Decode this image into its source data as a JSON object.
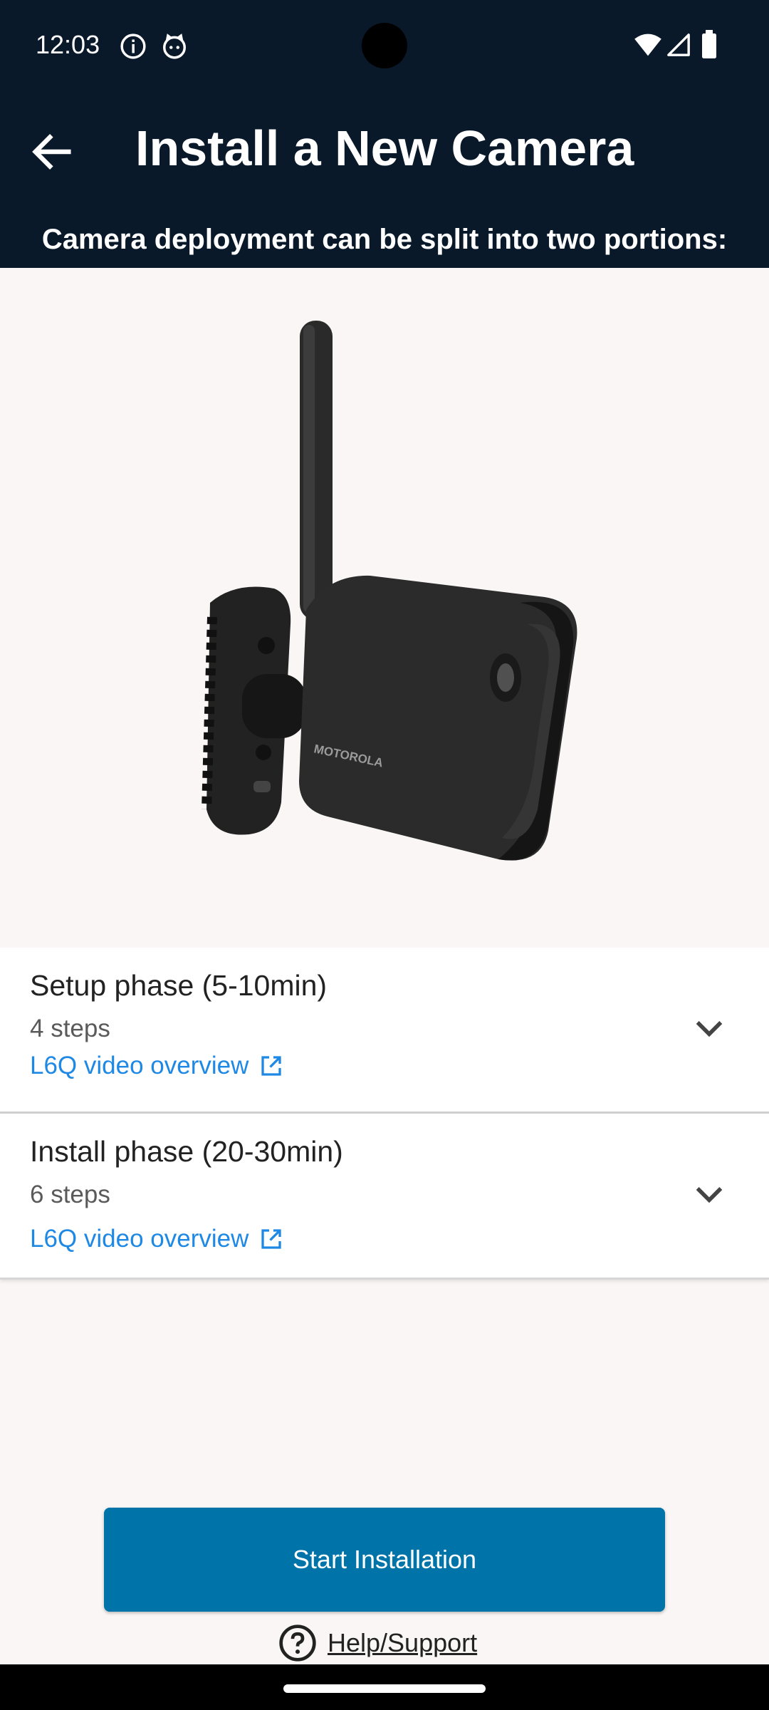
{
  "status_bar": {
    "time": "12:03",
    "icons": [
      "info-icon",
      "cat-icon",
      "wifi-icon",
      "signal-icon",
      "battery-icon"
    ]
  },
  "app_bar": {
    "title": "Install a New Camera",
    "back_icon": "arrow-back-icon"
  },
  "subtitle": "Camera deployment can be split into two portions:",
  "hero": {
    "brand_mark": "MOTOROLA"
  },
  "phases": [
    {
      "title": "Setup phase (5-10min)",
      "steps": "4 steps",
      "link": "L6Q video overview",
      "expand_icon": "chevron-down-icon"
    },
    {
      "title": "Install phase (20-30min)",
      "steps": "6 steps",
      "link": "L6Q video overview",
      "expand_icon": "chevron-down-icon"
    }
  ],
  "primary_button": "Start Installation",
  "help_link": "Help/Support",
  "colors": {
    "header_bg": "#0a1929",
    "page_bg": "#f9f6f5",
    "button_bg": "#0074a8",
    "link": "#1e88e5"
  }
}
